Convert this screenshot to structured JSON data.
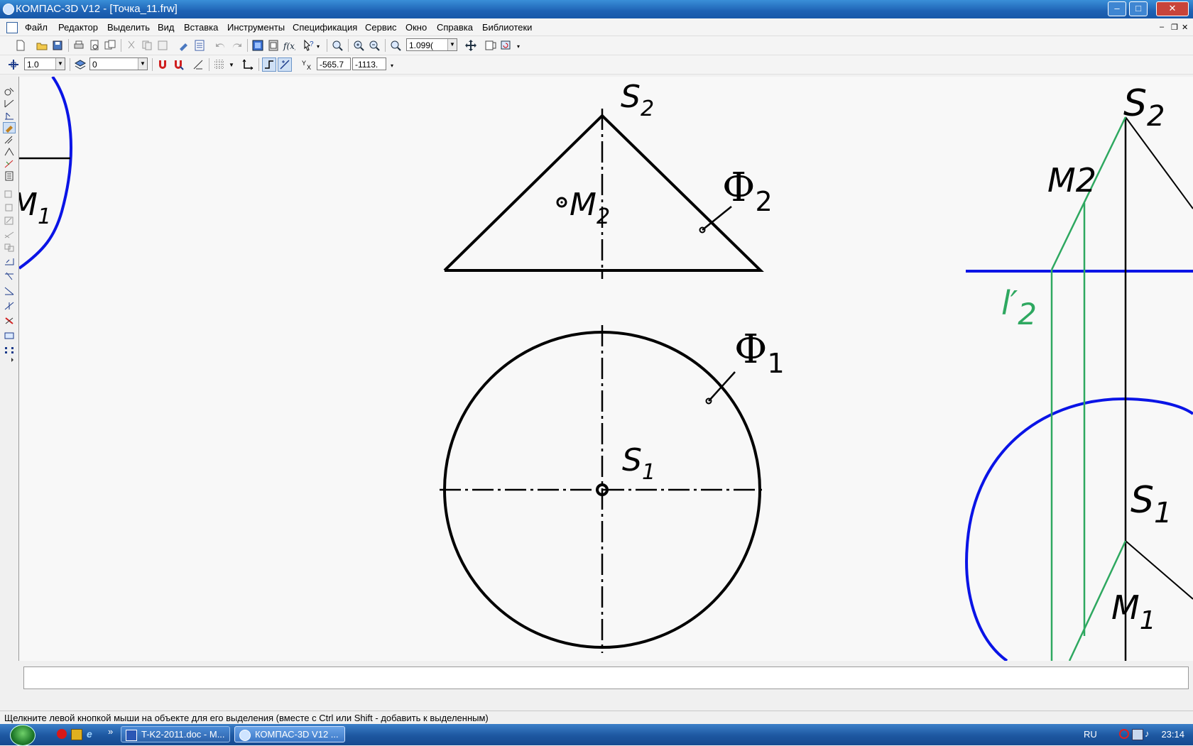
{
  "window": {
    "title": "КОМПАС-3D V12 - [Точка_11.frw]",
    "controls": {
      "minimize": "–",
      "maximize": "□",
      "close": "✕"
    }
  },
  "menu": {
    "items": [
      "Файл",
      "Редактор",
      "Выделить",
      "Вид",
      "Вставка",
      "Инструменты",
      "Спецификация",
      "Сервис",
      "Окно",
      "Справка",
      "Библиотеки"
    ],
    "doc_controls": {
      "minimize": "–",
      "restore": "❐",
      "close": "✕"
    }
  },
  "toolbar1": {
    "zoom_value": "1.099("
  },
  "toolbar2": {
    "step_value": "1.0",
    "layer_value": "0",
    "coord_x": "-565.7",
    "coord_y": "-1113."
  },
  "drawing": {
    "labels": {
      "S2_top": "S",
      "S2_top_sub": "2",
      "M2": "M",
      "M2_sub": "2",
      "F2": "Ф",
      "F2_sub": "2",
      "F1": "Ф",
      "F1_sub": "1",
      "S1_center": "S",
      "S1_center_sub": "1",
      "S2_right": "S",
      "S2_right_sub": "2",
      "M2_right": "M2",
      "l2_right": "l′",
      "l2_right_sub": "2",
      "S1_right": "S",
      "S1_right_sub": "1",
      "M1_right": "M",
      "M1_right_sub": "1",
      "M1_left": "M",
      "M1_left_sub": "1"
    },
    "colors": {
      "line": "#000000",
      "blue": "#0a14e6",
      "green": "#2ea860"
    }
  },
  "status": {
    "hint": "Щелкните левой кнопкой мыши на объекте для его выделения (вместе с Ctrl или Shift - добавить к выделенным)"
  },
  "taskbar": {
    "buttons": [
      "T-K2-2011.doc - M...",
      "КОМПАС-3D V12 ..."
    ],
    "lang": "RU",
    "clock": "23:14",
    "chevron": "»"
  }
}
